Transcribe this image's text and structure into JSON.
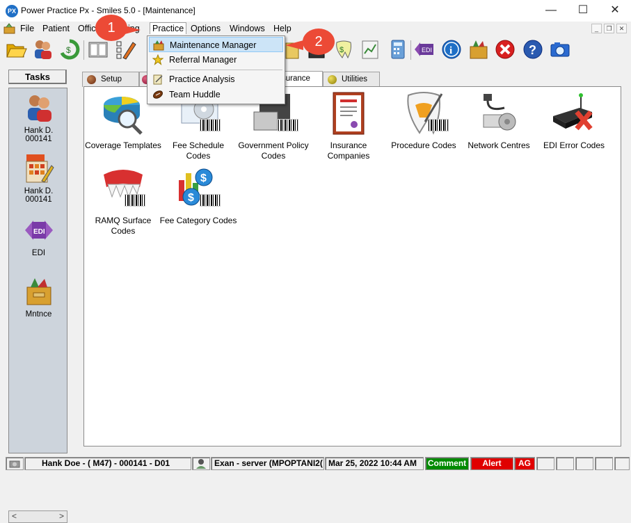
{
  "window": {
    "title": "Power Practice Px - Smiles 5.0 - [Maintenance]",
    "app_icon_text": "PX",
    "minimize": "—",
    "maximize": "☐",
    "close": "✕"
  },
  "menu": {
    "items": [
      "File",
      "Patient",
      "Offic",
      "ing",
      "Practice",
      "Options",
      "Windows",
      "Help"
    ]
  },
  "practice_menu": {
    "items": [
      "Maintenance Manager",
      "Referral Manager",
      "Practice Analysis",
      "Team Huddle"
    ]
  },
  "callouts": [
    "1",
    "2"
  ],
  "tasks": {
    "title": "Tasks",
    "items": [
      {
        "label1": "Hank D.",
        "label2": "000141",
        "icon": "patient-icon"
      },
      {
        "label1": "Hank D.",
        "label2": "000141",
        "icon": "chart-icon"
      },
      {
        "label1": "EDI",
        "label2": "",
        "icon": "edi-icon"
      },
      {
        "label1": "Mntnce",
        "label2": "",
        "icon": "maintenance-icon"
      }
    ],
    "scroll_left": "<",
    "scroll_right": ">"
  },
  "tabs": [
    "Setup",
    "surance",
    "Utilities"
  ],
  "maintenance_items": [
    {
      "label": "Coverage Templates"
    },
    {
      "label": "Fee Schedule Codes"
    },
    {
      "label": "Government Policy Codes"
    },
    {
      "label": "Insurance Companies"
    },
    {
      "label": "Procedure Codes"
    },
    {
      "label": "Network Centres"
    },
    {
      "label": "EDI Error Codes"
    },
    {
      "label": "RAMQ Surface Codes"
    },
    {
      "label": "Fee Category Codes"
    }
  ],
  "status": {
    "patient": "Hank Doe - ( M47) - 000141 - D01",
    "exam": "Exan - server (MPOPTANI2(",
    "datetime": "Mar 25, 2022 10:44 AM",
    "comment": "Comment",
    "alert": "Alert",
    "ag": "AG"
  },
  "colors": {
    "callout": "#ec4a36",
    "comment_bg": "#008a00",
    "alert_bg": "#e00000",
    "menu_highlight": "#cce4f7"
  }
}
